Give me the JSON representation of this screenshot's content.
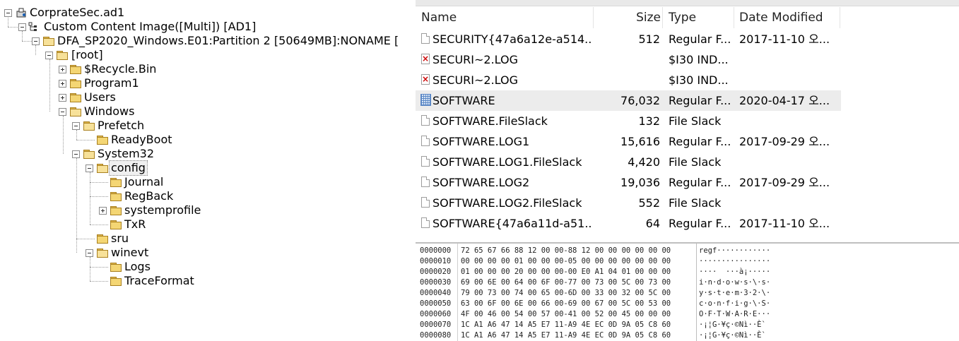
{
  "tree": {
    "root": "CorprateSec.ad1",
    "image": "Custom Content Image([Multi]) [AD1]",
    "partition": "DFA_SP2020_Windows.E01:Partition 2 [50649MB]:NONAME [",
    "root_folder": "[root]",
    "items": {
      "recycle": "$Recycle.Bin",
      "program1": "Program1",
      "users": "Users",
      "windows": "Windows",
      "prefetch": "Prefetch",
      "readyboot": "ReadyBoot",
      "system32": "System32",
      "config": "config",
      "journal": "Journal",
      "regback": "RegBack",
      "systemprofile": "systemprofile",
      "txr": "TxR",
      "sru": "sru",
      "winevt": "winevt",
      "logs": "Logs",
      "traceformat": "TraceFormat"
    }
  },
  "list": {
    "columns": {
      "name": "Name",
      "size": "Size",
      "type": "Type",
      "date": "Date Modified"
    },
    "rows": [
      {
        "icon": "file",
        "name": "SECURITY{47a6a12e-a514...",
        "size": "512",
        "type": "Regular F...",
        "date": "2017-11-10 오..."
      },
      {
        "icon": "deleted",
        "name": "SECURI~2.LOG",
        "size": "",
        "type": "$I30 IND...",
        "date": ""
      },
      {
        "icon": "deleted",
        "name": "SECURI~2.LOG",
        "size": "",
        "type": "$I30 IND...",
        "date": ""
      },
      {
        "icon": "registry",
        "name": "SOFTWARE",
        "size": "76,032",
        "type": "Regular F...",
        "date": "2020-04-17 오..."
      },
      {
        "icon": "file",
        "name": "SOFTWARE.FileSlack",
        "size": "132",
        "type": "File Slack",
        "date": ""
      },
      {
        "icon": "file",
        "name": "SOFTWARE.LOG1",
        "size": "15,616",
        "type": "Regular F...",
        "date": "2017-09-29 오..."
      },
      {
        "icon": "file",
        "name": "SOFTWARE.LOG1.FileSlack",
        "size": "4,420",
        "type": "File Slack",
        "date": ""
      },
      {
        "icon": "file",
        "name": "SOFTWARE.LOG2",
        "size": "19,036",
        "type": "Regular F...",
        "date": "2017-09-29 오..."
      },
      {
        "icon": "file",
        "name": "SOFTWARE.LOG2.FileSlack",
        "size": "552",
        "type": "File Slack",
        "date": ""
      },
      {
        "icon": "file",
        "name": "SOFTWARE{47a6a11d-a51...",
        "size": "64",
        "type": "Regular F...",
        "date": "2017-11-10 오..."
      }
    ]
  },
  "hex": {
    "rows": [
      {
        "offset": "0000000",
        "bytes": "72 65 67 66 88 12 00 00-88 12 00 00 00 00 00 00",
        "ascii": "regf············"
      },
      {
        "offset": "0000010",
        "bytes": "00 00 00 00 01 00 00 00-05 00 00 00 00 00 00 00",
        "ascii": "················"
      },
      {
        "offset": "0000020",
        "bytes": "01 00 00 00 20 00 00 00-00 E0 A1 04 01 00 00 00",
        "ascii": "····  ···à¡·····"
      },
      {
        "offset": "0000030",
        "bytes": "69 00 6E 00 64 00 6F 00-77 00 73 00 5C 00 73 00",
        "ascii": "i·n·d·o·w·s·\\·s·"
      },
      {
        "offset": "0000040",
        "bytes": "79 00 73 00 74 00 65 00-6D 00 33 00 32 00 5C 00",
        "ascii": "y·s·t·e·m·3·2·\\·"
      },
      {
        "offset": "0000050",
        "bytes": "63 00 6F 00 6E 00 66 00-69 00 67 00 5C 00 53 00",
        "ascii": "c·o·n·f·i·g·\\·S·"
      },
      {
        "offset": "0000060",
        "bytes": "4F 00 46 00 54 00 57 00-41 00 52 00 45 00 00 00",
        "ascii": "O·F·T·W·A·R·E···"
      },
      {
        "offset": "0000070",
        "bytes": "1C A1 A6 47 14 A5 E7 11-A9 4E EC 0D 9A 05 C8 60",
        "ascii": "·¡¦G·¥ç·©Nì··È`"
      },
      {
        "offset": "0000080",
        "bytes": "1C A1 A6 47 14 A5 E7 11-A9 4E EC 0D 9A 05 C8 60",
        "ascii": "·¡¦G·¥ç·©Nì··È`"
      }
    ]
  }
}
